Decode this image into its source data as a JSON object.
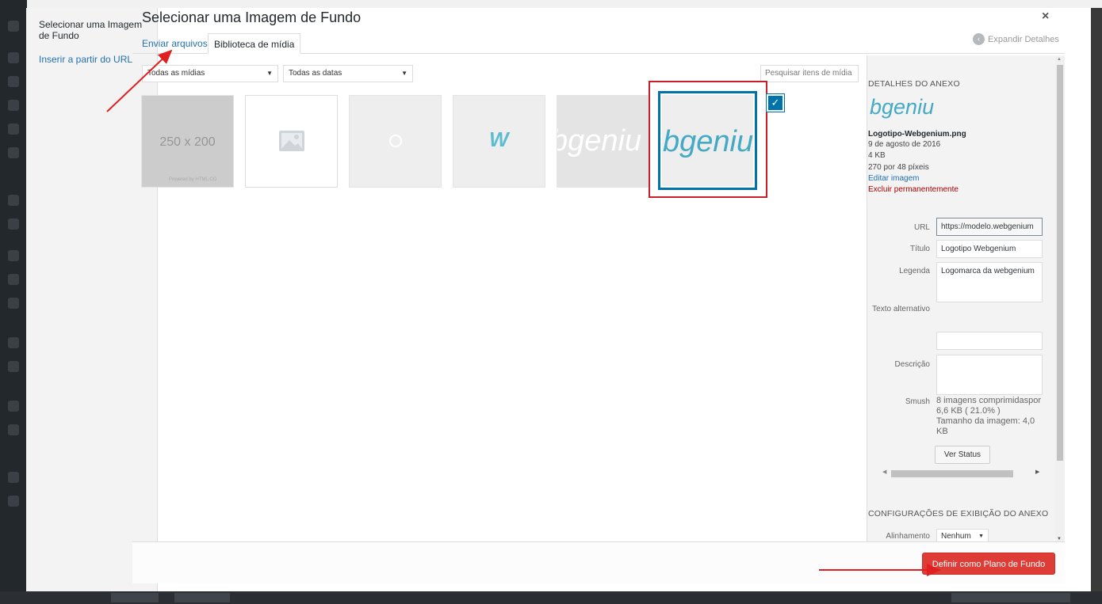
{
  "menu": {
    "active_label": "Selecionar uma Imagem de Fundo",
    "insert_url_label": "Inserir a partir do URL"
  },
  "header": {
    "title": "Selecionar uma Imagem de Fundo",
    "close_glyph": "×",
    "expand_label": "Expandir Detalhes"
  },
  "tabs": {
    "upload_label": "Enviar arquivos",
    "library_label": "Biblioteca de mídia"
  },
  "filters": {
    "type_value": "Todas as mídias",
    "date_value": "Todas as datas",
    "search_placeholder": "Pesquisar itens de mídia"
  },
  "thumbnails": {
    "placeholder_text": "250 x 200",
    "placeholder_sub": "Powered by HTML.CO",
    "logo_text": "bgeniu",
    "w_text": "W"
  },
  "details": {
    "heading": "DETALHES DO ANEXO",
    "preview_text": "bgeniu",
    "filename": "Logotipo-Webgenium.png",
    "date": "9 de agosto de 2016",
    "size": "4 KB",
    "dimensions": "270 por 48 píxeis",
    "edit_link": "Editar imagem",
    "delete_link": "Excluir permanentemente",
    "url_label": "URL",
    "url_value": "https://modelo.webgenium",
    "title_label": "Título",
    "title_value": "Logotipo Webgenium",
    "caption_label": "Legenda",
    "caption_value": "Logomarca da webgenium",
    "alt_label": "Texto alternativo",
    "alt_value": "",
    "description_label": "Descrição",
    "description_value": "",
    "smush_label": "Smush",
    "smush_line1": "8 imagens comprimidaspor 6,6 KB ( 21.0% )",
    "smush_line2": "Tamanho da imagem: 4,0 KB",
    "status_button": "Ver Status"
  },
  "display_settings": {
    "heading": "CONFIGURAÇÕES DE EXIBIÇÃO DO ANEXO",
    "align_label": "Alinhamento",
    "align_value": "Nenhum"
  },
  "footer": {
    "primary_button": "Definir como Plano de Fundo"
  },
  "colors": {
    "accent": "#0073aa",
    "primary_button": "#dd3d36",
    "annotation_red": "#e02020"
  }
}
